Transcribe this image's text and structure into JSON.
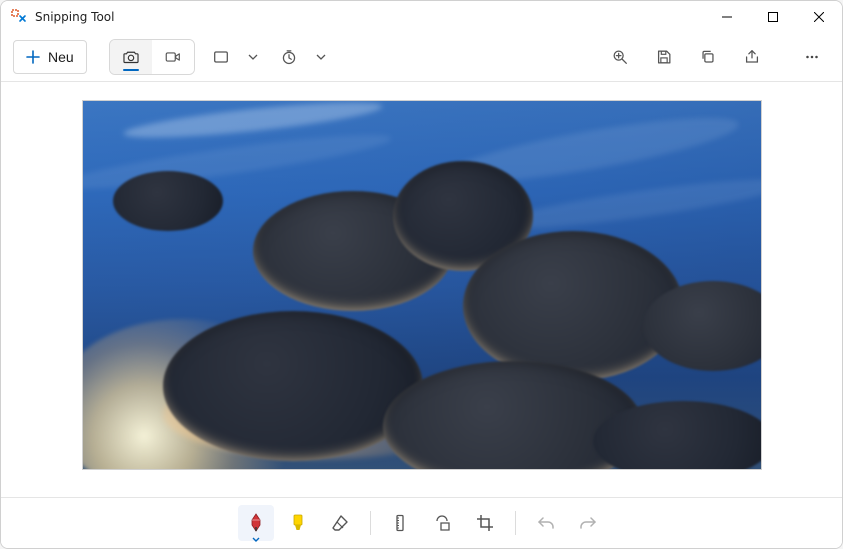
{
  "titlebar": {
    "app_name": "Snipping Tool"
  },
  "toolbar": {
    "new_label": "Neu"
  },
  "icons": {
    "plus": "plus-icon",
    "camera": "camera-icon",
    "video": "video-icon",
    "shape_mode": "snip-mode-icon",
    "delay": "delay-icon",
    "zoom": "zoom-icon",
    "save": "save-icon",
    "copy": "copy-icon",
    "share": "share-icon",
    "more": "more-icon",
    "pen": "pen-icon",
    "highlighter": "highlighter-icon",
    "eraser": "eraser-icon",
    "ruler": "ruler-icon",
    "touch_draw": "shapes-icon",
    "crop": "crop-icon",
    "undo": "undo-icon",
    "redo": "redo-icon",
    "minimize": "minimize-icon",
    "maximize": "maximize-icon",
    "close": "close-icon"
  },
  "content": {
    "image_description": "Photograph of a dramatic sky with dark storm clouds against a deep blue sky, golden sunset light from the lower-left rimming the cloud edges."
  }
}
